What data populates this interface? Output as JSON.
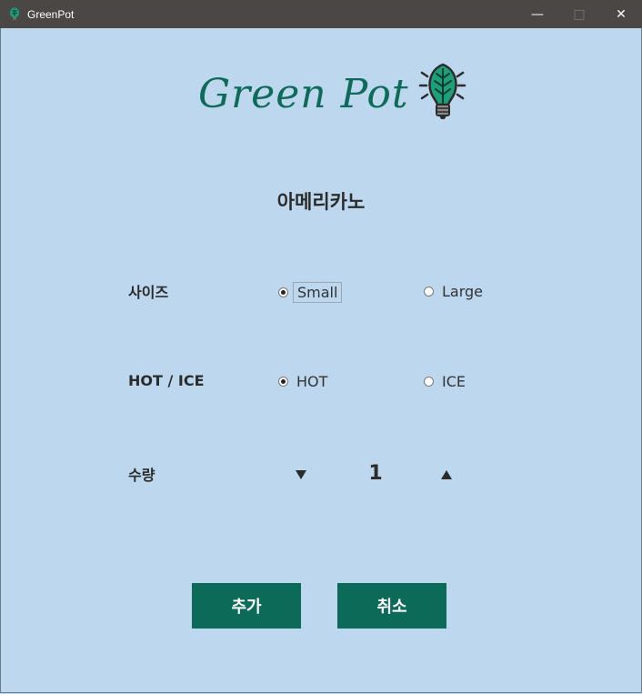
{
  "window": {
    "title": "GreenPot",
    "app_icon": "leaf-bulb-icon",
    "minimize_glyph": "—",
    "maximize_glyph": "□",
    "close_glyph": "✕"
  },
  "logo": {
    "text": "Green Pot",
    "icon": "lightbulb-leaf-icon",
    "color": "#0e6b5a"
  },
  "product": {
    "name": "아메리카노"
  },
  "options": {
    "size": {
      "label": "사이즈",
      "choices": [
        {
          "label": "Small",
          "selected": true
        },
        {
          "label": "Large",
          "selected": false
        }
      ]
    },
    "temperature": {
      "label": "HOT / ICE",
      "choices": [
        {
          "label": "HOT",
          "selected": true
        },
        {
          "label": "ICE",
          "selected": false
        }
      ]
    },
    "quantity": {
      "label": "수량",
      "value": "1",
      "decrease_icon": "triangle-down-icon",
      "increase_icon": "triangle-up-icon"
    }
  },
  "buttons": {
    "add": "추가",
    "cancel": "취소"
  },
  "colors": {
    "background": "#bdd7ee",
    "accent": "#0c6a58",
    "titlebar": "#4a4744"
  }
}
